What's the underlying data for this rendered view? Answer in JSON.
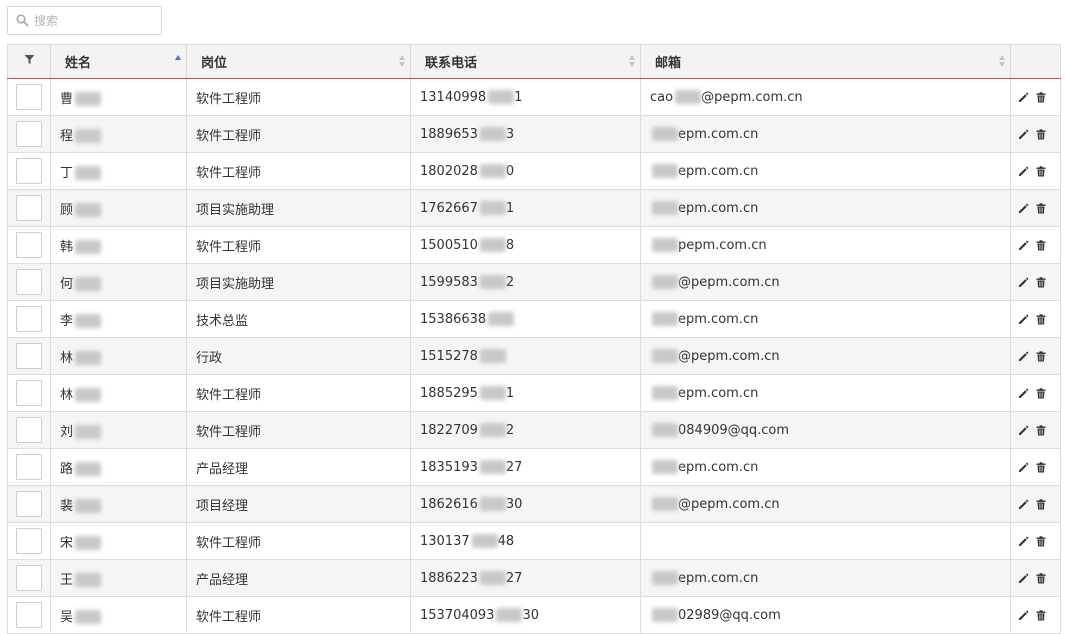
{
  "search": {
    "placeholder": "搜索"
  },
  "table": {
    "columns": [
      "姓名",
      "岗位",
      "联系电话",
      "邮箱"
    ],
    "rows": [
      {
        "name": "曹",
        "position": "软件工程师",
        "phone": "13140998",
        "phone_tail": "1",
        "email_head": "cao",
        "email": "@pepm.com.cn"
      },
      {
        "name": "程",
        "position": "软件工程师",
        "phone": "1889653",
        "phone_tail": "3",
        "email_head": "",
        "email": "epm.com.cn"
      },
      {
        "name": "丁",
        "position": "软件工程师",
        "phone": "1802028",
        "phone_tail": "0",
        "email_head": "",
        "email": "epm.com.cn"
      },
      {
        "name": "顾",
        "position": "项目实施助理",
        "phone": "1762667",
        "phone_tail": "1",
        "email_head": "",
        "email": "epm.com.cn"
      },
      {
        "name": "韩",
        "position": "软件工程师",
        "phone": "1500510",
        "phone_tail": "8",
        "email_head": "",
        "email": "pepm.com.cn"
      },
      {
        "name": "何",
        "position": "项目实施助理",
        "phone": "1599583",
        "phone_tail": "2",
        "email_head": "",
        "email": "@pepm.com.cn"
      },
      {
        "name": "李",
        "position": "技术总监",
        "phone": "15386638",
        "phone_tail": "",
        "email_head": "",
        "email": "epm.com.cn"
      },
      {
        "name": "林",
        "position": "行政",
        "phone": "1515278",
        "phone_tail": "",
        "email_head": "",
        "email": "@pepm.com.cn"
      },
      {
        "name": "林",
        "position": "软件工程师",
        "phone": "1885295",
        "phone_tail": "1",
        "email_head": "",
        "email": "epm.com.cn"
      },
      {
        "name": "刘",
        "position": "软件工程师",
        "phone": "1822709",
        "phone_tail": "2",
        "email_head": "",
        "email": "084909@qq.com"
      },
      {
        "name": "路",
        "position": "产品经理",
        "phone": "1835193",
        "phone_tail": "27",
        "email_head": "",
        "email": "epm.com.cn"
      },
      {
        "name": "裴",
        "position": "项目经理",
        "phone": "1862616",
        "phone_tail": "30",
        "email_head": "",
        "email": "@pepm.com.cn"
      },
      {
        "name": "宋",
        "position": "软件工程师",
        "phone": "130137",
        "phone_tail": "48",
        "email_head": "",
        "email": ""
      },
      {
        "name": "王",
        "position": "产品经理",
        "phone": "1886223",
        "phone_tail": "27",
        "email_head": "",
        "email": "epm.com.cn"
      },
      {
        "name": "吴",
        "position": "软件工程师",
        "phone": "153704093",
        "phone_tail": "30",
        "email_head": "",
        "email": "02989@qq.com"
      }
    ]
  },
  "icons": {
    "filter": "filter-icon",
    "edit": "pencil-icon",
    "delete": "trash-icon",
    "search": "search-icon"
  },
  "colors": {
    "header_underline": "#c94a4a",
    "sort_active": "#4a6fd0",
    "row_stripe": "#f5f5f5"
  }
}
